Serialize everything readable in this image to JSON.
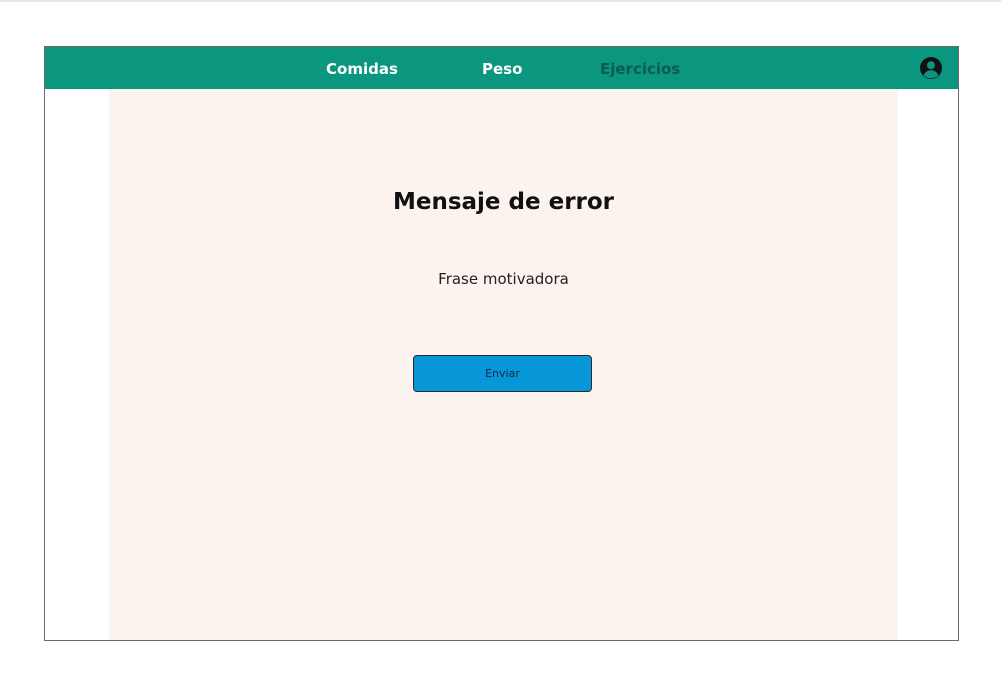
{
  "nav": {
    "items": [
      {
        "label": "Comidas",
        "active": false
      },
      {
        "label": "Peso",
        "active": false
      },
      {
        "label": "Ejercicios",
        "active": true
      }
    ],
    "profile_icon": "user-circle-icon"
  },
  "main": {
    "title": "Mensaje de error",
    "subtitle": "Frase motivadora",
    "button_label": "Enviar"
  },
  "colors": {
    "navbar": "#0b9680",
    "nav_text": "#ffffff",
    "nav_active_text": "#0e5a52",
    "content_background": "#fcf3ef",
    "button": "#0796d8"
  }
}
